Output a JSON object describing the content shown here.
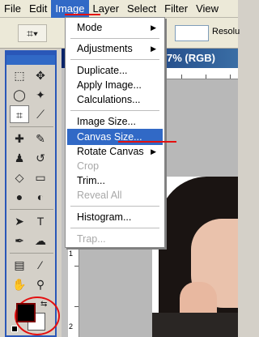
{
  "menubar": {
    "items": [
      "File",
      "Edit",
      "Image",
      "Layer",
      "Select",
      "Filter",
      "View"
    ],
    "active_index": 2
  },
  "options_bar": {
    "tool_icon": "crop-icon",
    "resolution_label": "Resolu"
  },
  "document": {
    "title_fragment": "7% (RGB)",
    "ruler_vertical_labels": [
      "1",
      "2"
    ]
  },
  "image_menu": {
    "items": [
      {
        "label": "Mode",
        "submenu": true,
        "enabled": true
      },
      {
        "label": "Adjustments",
        "submenu": true,
        "enabled": true
      },
      {
        "label": "Duplicate...",
        "submenu": false,
        "enabled": true
      },
      {
        "label": "Apply Image...",
        "submenu": false,
        "enabled": true
      },
      {
        "label": "Calculations...",
        "submenu": false,
        "enabled": true
      },
      {
        "label": "Image Size...",
        "submenu": false,
        "enabled": true
      },
      {
        "label": "Canvas Size...",
        "submenu": false,
        "enabled": true,
        "highlighted": true
      },
      {
        "label": "Rotate Canvas",
        "submenu": true,
        "enabled": true
      },
      {
        "label": "Crop",
        "submenu": false,
        "enabled": false
      },
      {
        "label": "Trim...",
        "submenu": false,
        "enabled": true
      },
      {
        "label": "Reveal All",
        "submenu": false,
        "enabled": false
      },
      {
        "label": "Histogram...",
        "submenu": false,
        "enabled": true
      },
      {
        "label": "Trap...",
        "submenu": false,
        "enabled": false
      }
    ]
  },
  "colors": {
    "highlight": "#3169c6",
    "annotation_red": "#e41010",
    "foreground_color": "#000000",
    "background_color": "#ffffff"
  }
}
